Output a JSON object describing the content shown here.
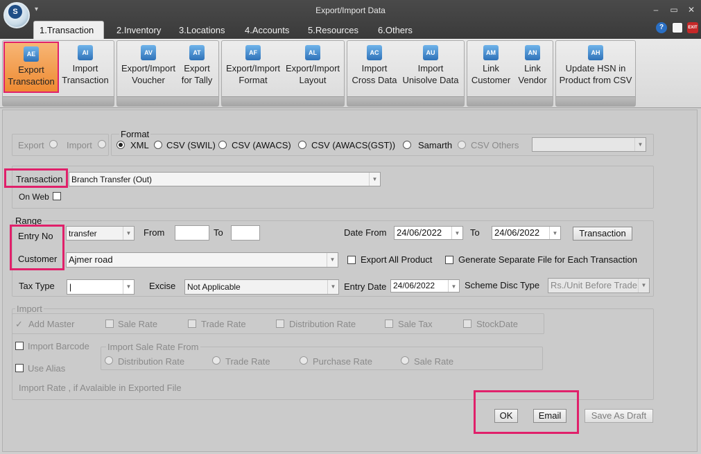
{
  "window": {
    "title": "Export/Import Data",
    "controls": {
      "minimize": "–",
      "maximize": "▭",
      "close": "✕"
    },
    "logo_letter": "S"
  },
  "tabs": [
    {
      "label": "1.Transaction",
      "active": true
    },
    {
      "label": "2.Inventory"
    },
    {
      "label": "3.Locations"
    },
    {
      "label": "4.Accounts"
    },
    {
      "label": "5.Resources"
    },
    {
      "label": "6.Others"
    }
  ],
  "tab_icons": {
    "help": "?",
    "exit": "EXIT"
  },
  "ribbon": [
    {
      "line1": "Export",
      "line2": "Transaction",
      "icon": "AE"
    },
    {
      "line1": "Import",
      "line2": "Transaction",
      "icon": "AI"
    },
    {
      "line1": "Export/Import",
      "line2": "Voucher",
      "icon": "AV"
    },
    {
      "line1": "Export",
      "line2": "for Tally",
      "icon": "AT"
    },
    {
      "line1": "Export/Import",
      "line2": "Format",
      "icon": "AF"
    },
    {
      "line1": "Export/Import",
      "line2": "Layout",
      "icon": "AL"
    },
    {
      "line1": "Import",
      "line2": "Cross Data",
      "icon": "AC"
    },
    {
      "line1": "Import",
      "line2": "Unisolve Data",
      "icon": "AU"
    },
    {
      "line1": "Link",
      "line2": "Customer",
      "icon": "AM"
    },
    {
      "line1": "Link",
      "line2": "Vendor",
      "icon": "AN"
    },
    {
      "line1": "Update HSN in",
      "line2": "Product from CSV",
      "icon": "AH"
    }
  ],
  "mode": {
    "export_label": "Export",
    "import_label": "Import"
  },
  "format": {
    "title": "Format",
    "options": [
      "XML",
      "CSV (SWIL)",
      "CSV (AWACS)",
      "CSV (AWACS(GST))",
      "Samarth",
      "CSV Others"
    ],
    "selected": "XML"
  },
  "transaction": {
    "label": "Transaction",
    "value": "Branch Transfer (Out)",
    "on_web_label": "On Web"
  },
  "range": {
    "title": "Range",
    "entry_no_label": "Entry No",
    "entry_no_value": "transfer",
    "from_label": "From",
    "to_label": "To",
    "date_from_label": "Date From",
    "date_from": "24/06/2022",
    "date_to_label": "To",
    "date_to": "24/06/2022",
    "transaction_button": "Transaction",
    "customer_label": "Customer",
    "customer_value": "Ajmer road",
    "export_all_product": "Export All Product",
    "separate_file": "Generate Separate File for Each Transaction",
    "tax_type_label": "Tax Type",
    "excise_label": "Excise",
    "excise_value": "Not Applicable",
    "entry_date_label": "Entry Date",
    "entry_date": "24/06/2022",
    "scheme_disc_label": "Scheme Disc Type",
    "scheme_disc_value": "Rs./Unit Before Trade"
  },
  "import": {
    "title": "Import",
    "add_master": "Add Master",
    "sale_rate": "Sale Rate",
    "trade_rate": "Trade Rate",
    "distribution_rate": "Distribution Rate",
    "sale_tax": "Sale Tax",
    "stock_date": "StockDate",
    "import_barcode": "Import Barcode",
    "use_alias": "Use Alias",
    "import_sale_rate_from": "Import Sale Rate From",
    "rate_from": [
      "Distribution Rate",
      "Trade Rate",
      "Purchase Rate",
      "Sale Rate"
    ],
    "note": "Import Rate , if Avalaible in Exported File"
  },
  "buttons": {
    "ok": "OK",
    "email": "Email",
    "save_as_draft": "Save As Draft"
  }
}
